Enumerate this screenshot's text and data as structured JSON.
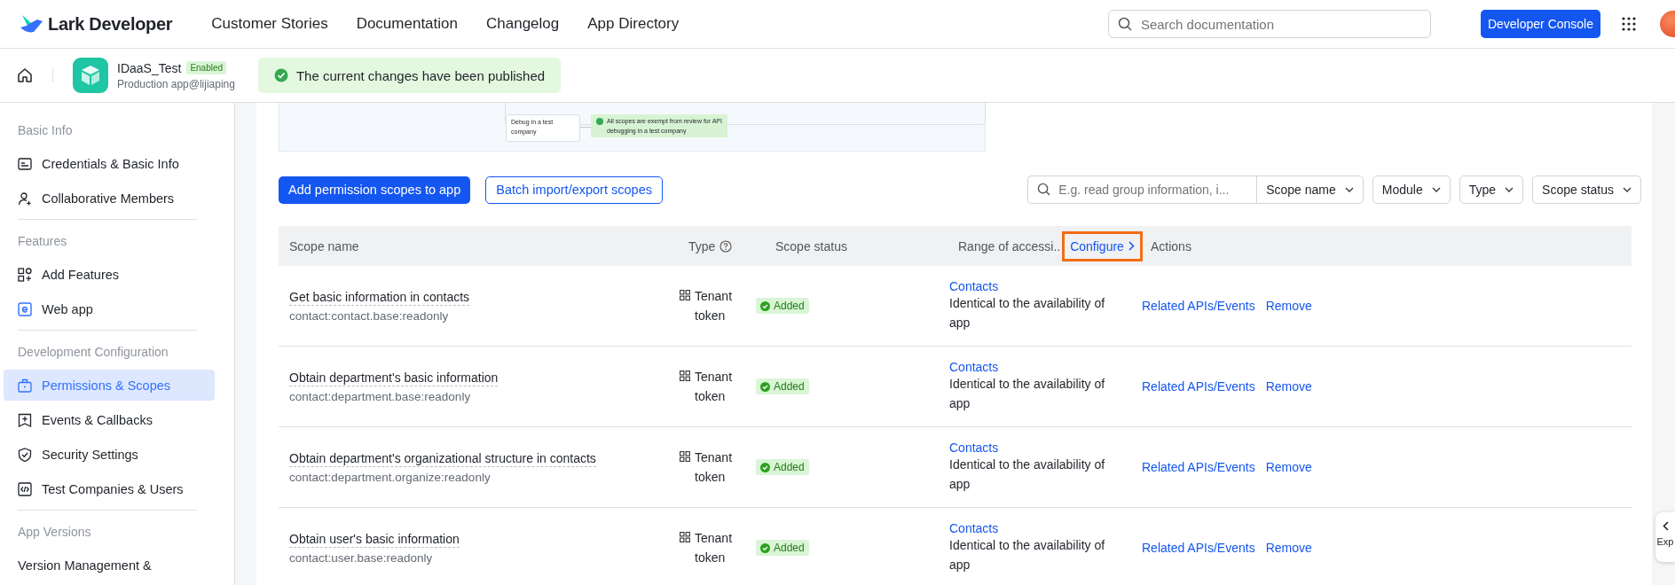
{
  "topbar": {
    "brand": "Lark Developer",
    "nav": [
      "Customer Stories",
      "Documentation",
      "Changelog",
      "App Directory"
    ],
    "search": {
      "placeholder": "Search documentation"
    },
    "console_button": "Developer Console"
  },
  "app": {
    "name": "IDaaS_Test",
    "status": "Enabled",
    "subtitle": "Production app@lijiaping"
  },
  "toast": {
    "text": "The current changes have been published"
  },
  "sidebar": {
    "sections": [
      {
        "title": "Basic Info",
        "items": [
          {
            "label": "Credentials & Basic Info",
            "selected": false
          },
          {
            "label": "Collaborative Members",
            "selected": false
          }
        ]
      },
      {
        "title": "Features",
        "items": [
          {
            "label": "Add Features",
            "selected": false
          },
          {
            "label": "Web app",
            "selected": false
          }
        ]
      },
      {
        "title": "Development Configuration",
        "items": [
          {
            "label": "Permissions & Scopes",
            "selected": true
          },
          {
            "label": "Events & Callbacks",
            "selected": false
          },
          {
            "label": "Security Settings",
            "selected": false
          },
          {
            "label": "Test Companies & Users",
            "selected": false
          }
        ]
      },
      {
        "title": "App Versions",
        "items": [
          {
            "label": "Version Management &",
            "selected": false
          }
        ]
      }
    ]
  },
  "diagram": {
    "node": "Debug in a test company",
    "result": "All scopes are exempt from review for API debugging in a test company"
  },
  "actions": {
    "primary": "Add permission scopes to app",
    "secondary": "Batch import/export scopes"
  },
  "filters": {
    "search": {
      "placeholder": "E.g. read group information, i..."
    },
    "dropdowns": [
      "Scope name",
      "Module",
      "Type",
      "Scope status"
    ]
  },
  "table": {
    "columns": [
      "Scope name",
      "Type",
      "Scope status",
      "Range of accessi..",
      "Actions"
    ],
    "configure": {
      "label": "Configure",
      "highlighted": true
    },
    "rows": [
      {
        "name": "Get basic information in contacts",
        "scope": "contact:contact.base:readonly",
        "type": "Tenant token",
        "status": "Added",
        "range_link": "Contacts",
        "range": "Identical to the availability of app",
        "actions": [
          "Related APIs/Events",
          "Remove"
        ]
      },
      {
        "name": "Obtain department's basic information",
        "scope": "contact:department.base:readonly",
        "type": "Tenant token",
        "status": "Added",
        "range_link": "Contacts",
        "range": "Identical to the availability of app",
        "actions": [
          "Related APIs/Events",
          "Remove"
        ]
      },
      {
        "name": "Obtain department's organizational structure in contacts",
        "scope": "contact:department.organize:readonly",
        "type": "Tenant token",
        "status": "Added",
        "range_link": "Contacts",
        "range": "Identical to the availability of app",
        "actions": [
          "Related APIs/Events",
          "Remove"
        ]
      },
      {
        "name": "Obtain user's basic information",
        "scope": "contact:user.base:readonly",
        "type": "Tenant token",
        "status": "Added",
        "range_link": "Contacts",
        "range": "Identical to the availability of app",
        "actions": [
          "Related APIs/Events",
          "Remove"
        ]
      }
    ]
  },
  "expand_tab": {
    "label": "Exp"
  }
}
